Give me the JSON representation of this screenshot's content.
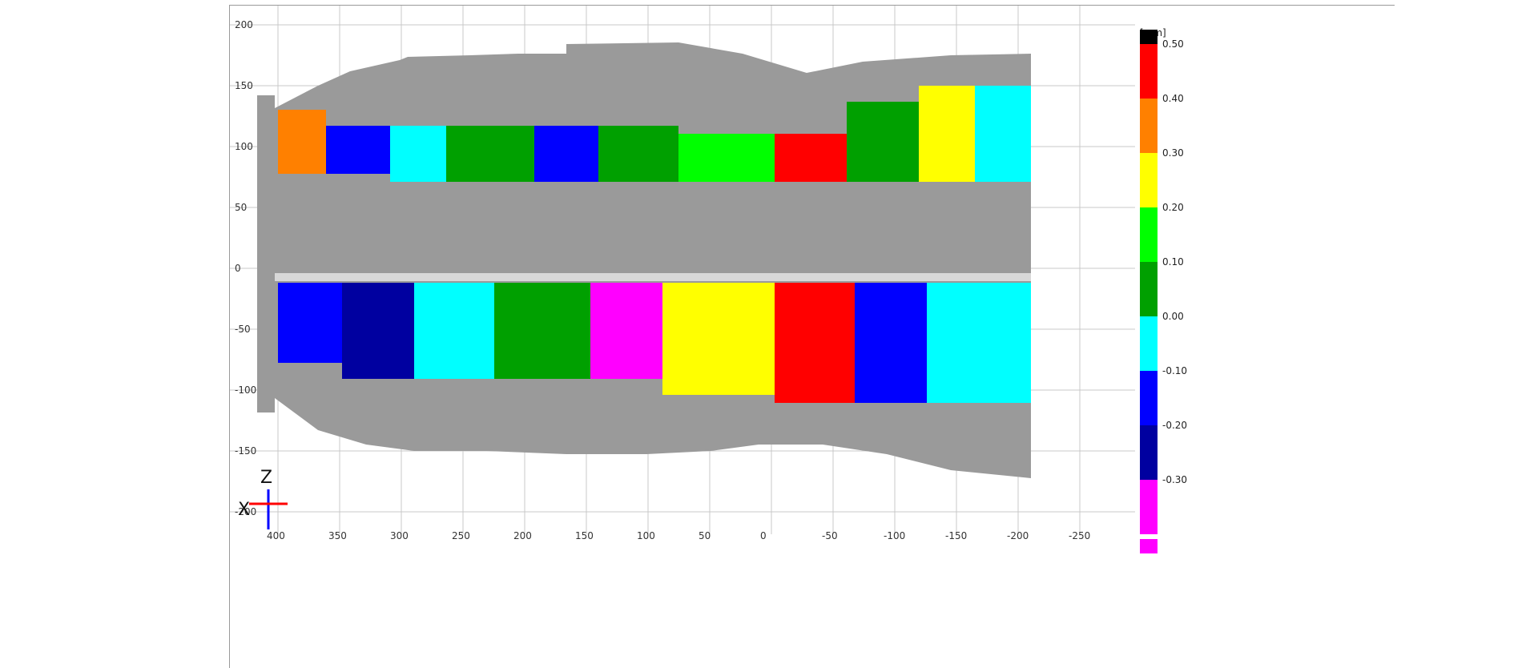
{
  "viewer": {
    "x_ticks": [
      "400",
      "350",
      "300",
      "250",
      "200",
      "150",
      "100",
      "50",
      "0",
      "-50",
      "-100",
      "-150",
      "-200",
      "-250"
    ],
    "y_ticks": [
      "200",
      "150",
      "100",
      "50",
      "0",
      "-50",
      "-100",
      "-150",
      "-200"
    ]
  },
  "legend": {
    "unit": "[mm]",
    "entries": [
      {
        "label": "0.50",
        "color": "#ff0000"
      },
      {
        "label": "0.40",
        "color": "#ff8000"
      },
      {
        "label": "0.30",
        "color": "#ffff00"
      },
      {
        "label": "0.20",
        "color": "#00ff00"
      },
      {
        "label": "0.10",
        "color": "#00a000"
      },
      {
        "label": "0.00",
        "color": "#00ffff"
      },
      {
        "label": "-0.10",
        "color": "#0000ff"
      },
      {
        "label": "-0.20",
        "color": "#0000a0"
      },
      {
        "label": "-0.30",
        "color": "#ff00ff"
      }
    ],
    "over_color": "#000000",
    "under_color": "#ff00ff"
  },
  "triad": {
    "z_label": "Z",
    "x_label": "X"
  },
  "colors": {
    "part_gray": "#9a9a9a",
    "grid": "#c8c8c8"
  }
}
